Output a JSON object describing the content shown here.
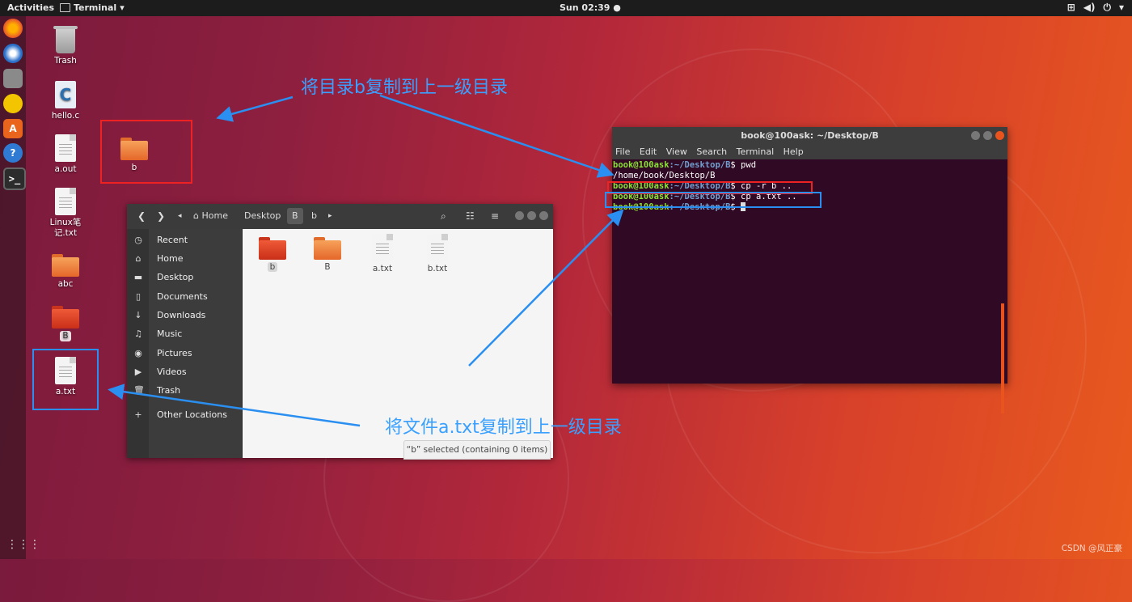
{
  "topbar": {
    "activities": "Activities",
    "app_name": "Terminal",
    "app_arrow": "▾",
    "clock": "Sun 02:39 ●"
  },
  "desktop_icons": {
    "trash": "Trash",
    "hello_c": "hello.c",
    "a_out": "a.out",
    "linux_notes": "Linux笔记.txt",
    "abc": "abc",
    "folder_B": "B",
    "a_txt": "a.txt",
    "folder_b": "b"
  },
  "annotations": {
    "top": "将目录b复制到上一级目录",
    "bottom": "将文件a.txt复制到上一级目录"
  },
  "file_manager": {
    "breadcrumbs": [
      "Home",
      "Desktop",
      "B",
      "b"
    ],
    "sidebar": [
      "Recent",
      "Home",
      "Desktop",
      "Documents",
      "Downloads",
      "Music",
      "Pictures",
      "Videos",
      "Trash",
      "Other Locations"
    ],
    "files": [
      "b",
      "B",
      "a.txt",
      "b.txt"
    ],
    "status": "“b” selected  (containing 0 items)"
  },
  "terminal": {
    "title": "book@100ask: ~/Desktop/B",
    "menu": [
      "File",
      "Edit",
      "View",
      "Search",
      "Terminal",
      "Help"
    ],
    "user_host": "book@100ask",
    "path": ":~/Desktop/B",
    "lines": [
      {
        "cmd": "$ pwd"
      },
      {
        "output": "/home/book/Desktop/B"
      },
      {
        "cmd": "$ cp -r b .."
      },
      {
        "cmd": "$ cp a.txt .."
      },
      {
        "cmd": "$ "
      }
    ]
  },
  "watermark": "CSDN @风正豪"
}
